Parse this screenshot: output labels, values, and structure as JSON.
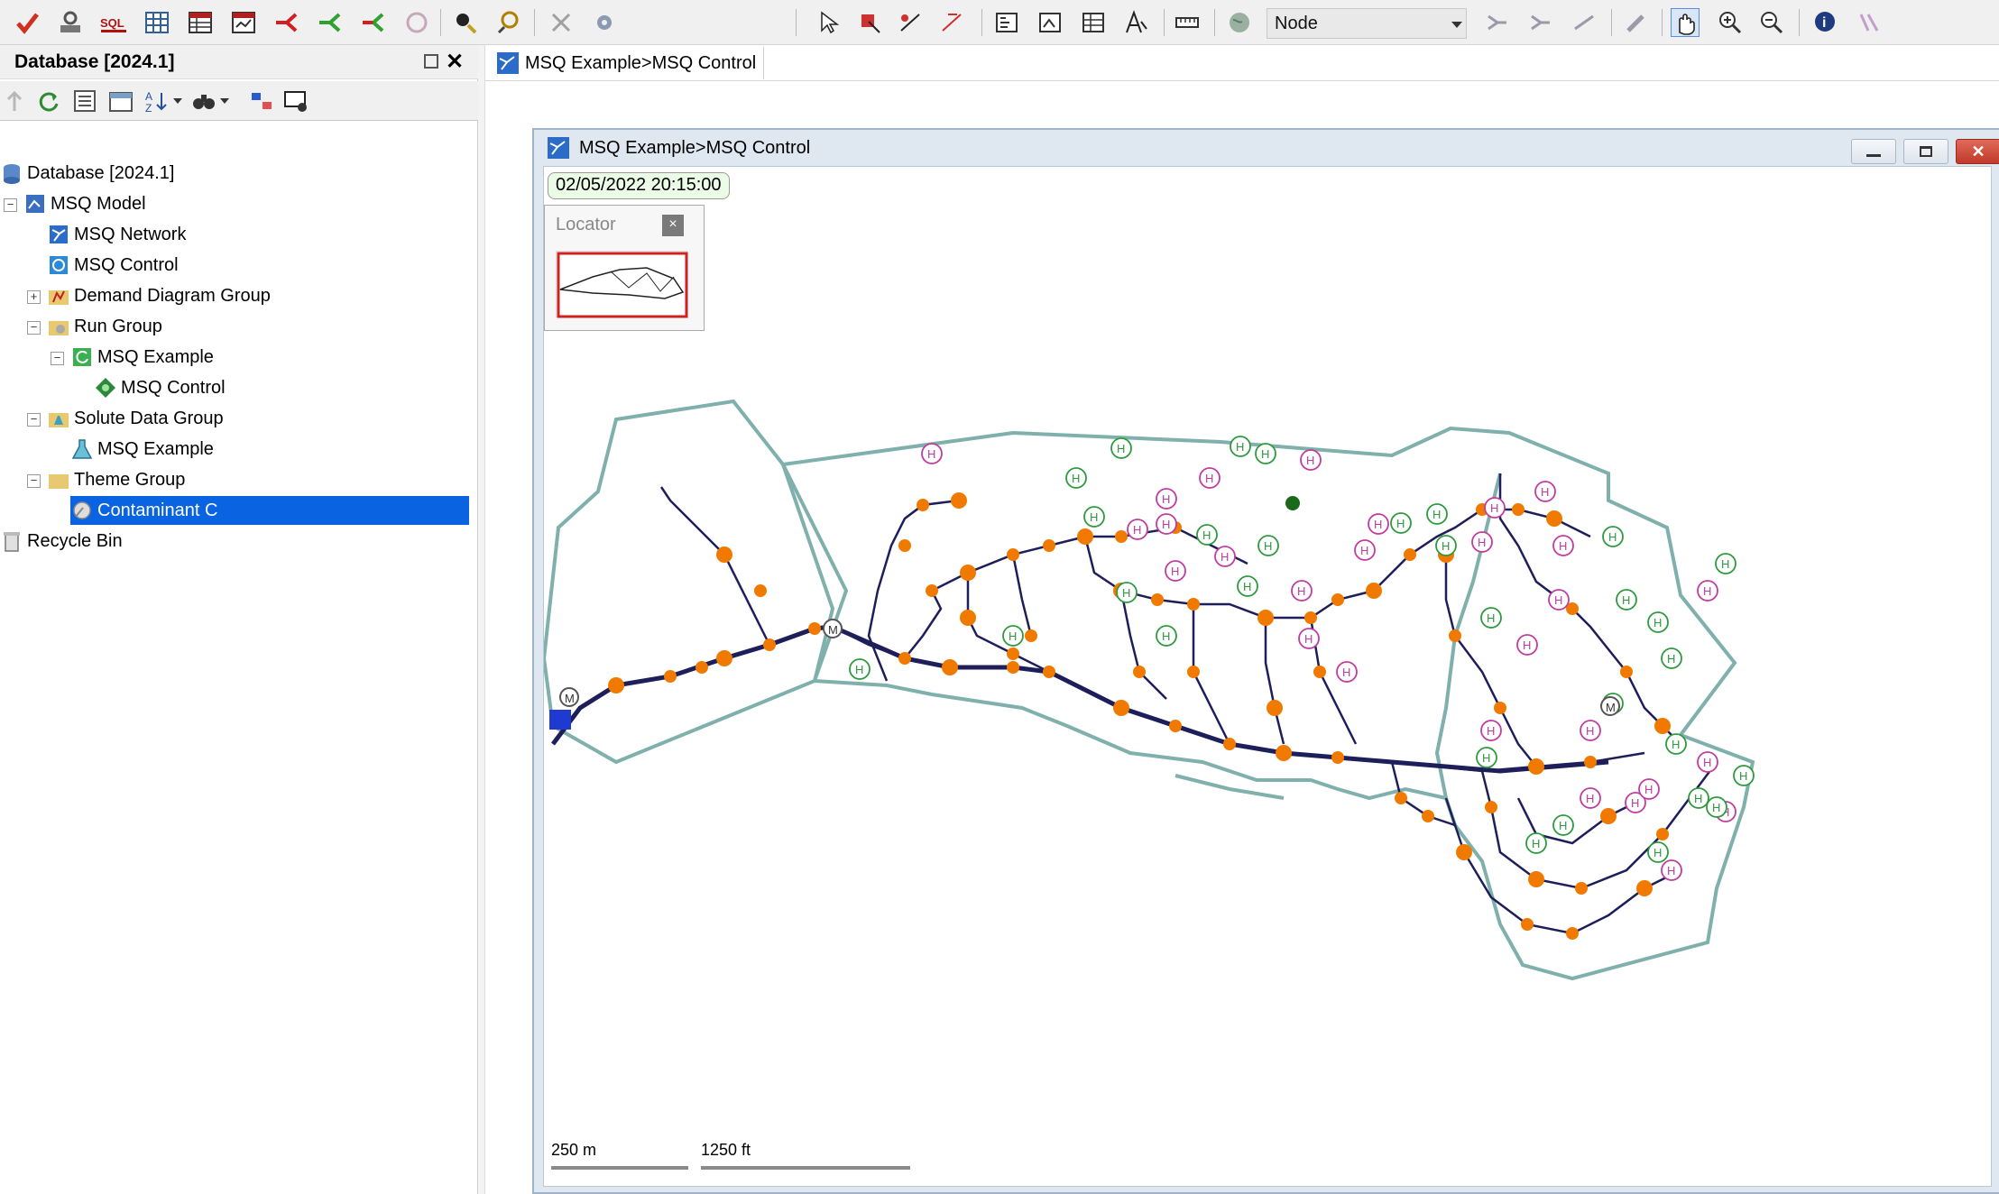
{
  "panel": {
    "title": "Database [2024.1]"
  },
  "toolbar": {
    "node_select_value": "Node"
  },
  "tree": {
    "items": [
      {
        "label": "Database [2024.1]"
      },
      {
        "label": "MSQ Model"
      },
      {
        "label": "MSQ Network"
      },
      {
        "label": "MSQ Control"
      },
      {
        "label": "Demand Diagram Group"
      },
      {
        "label": "Run Group"
      },
      {
        "label": "MSQ Example"
      },
      {
        "label": "MSQ Control"
      },
      {
        "label": "Solute Data Group"
      },
      {
        "label": "MSQ Example"
      },
      {
        "label": "Theme Group"
      },
      {
        "label": "Contaminant C"
      },
      {
        "label": "Recycle Bin"
      }
    ]
  },
  "tab": {
    "label": "MSQ Example>MSQ Control"
  },
  "window": {
    "title": "MSQ Example>MSQ Control",
    "timestamp": "02/05/2022 20:15:00",
    "locator_title": "Locator",
    "locator_close": "×"
  },
  "scale": {
    "metric": "250 m",
    "imperial": "1250 ft"
  },
  "map": {
    "hydrant_label": "H",
    "meter_label": "M",
    "colors": {
      "zone": "#7fb0ac",
      "pipe": "#1e1e5a",
      "node": "#f07a00",
      "hydrant_green": "#2e9a3e",
      "hydrant_pink": "#c03ca0"
    }
  }
}
